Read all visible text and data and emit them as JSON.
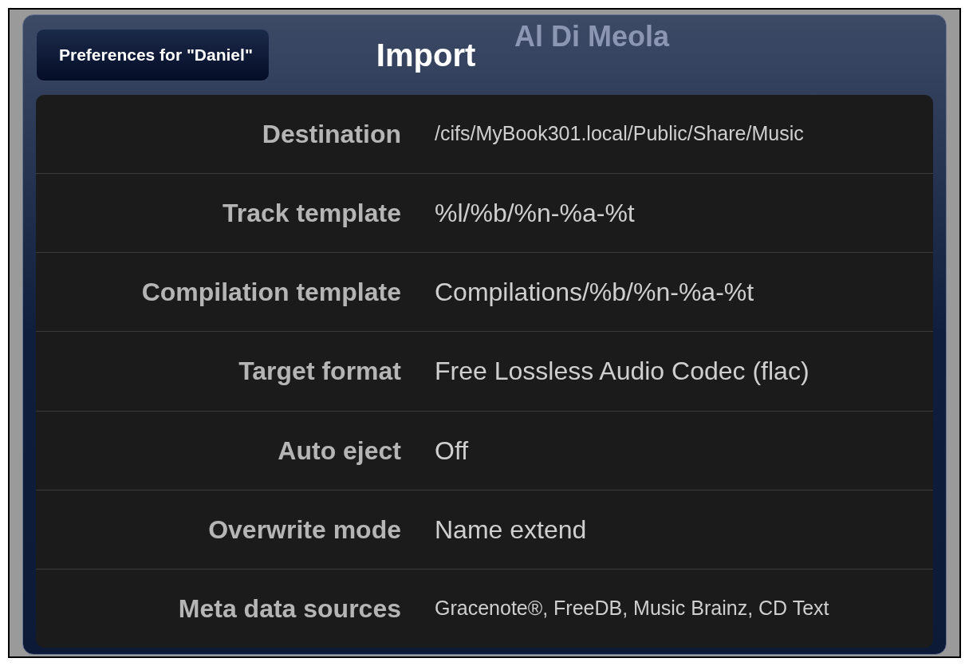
{
  "background": {
    "artist": "Al Di Meola"
  },
  "nav": {
    "back_button": "Preferences for \"Daniel\"",
    "title": "Import"
  },
  "settings": [
    {
      "label": "Destination",
      "value": "/cifs/MyBook301.local/Public/Share/Music",
      "kind": "small"
    },
    {
      "label": "Track template",
      "value": "%l/%b/%n-%a-%t",
      "kind": "normal"
    },
    {
      "label": "Compilation template",
      "value": "Compilations/%b/%n-%a-%t",
      "kind": "normal"
    },
    {
      "label": "Target format",
      "value": "Free Lossless Audio Codec (flac)",
      "kind": "normal"
    },
    {
      "label": "Auto eject",
      "value": "Off",
      "kind": "normal"
    },
    {
      "label": "Overwrite mode",
      "value": "Name extend",
      "kind": "normal"
    },
    {
      "label": "Meta data sources",
      "value": "Gracenote®, FreeDB, Music Brainz, CD Text",
      "kind": "small"
    }
  ]
}
